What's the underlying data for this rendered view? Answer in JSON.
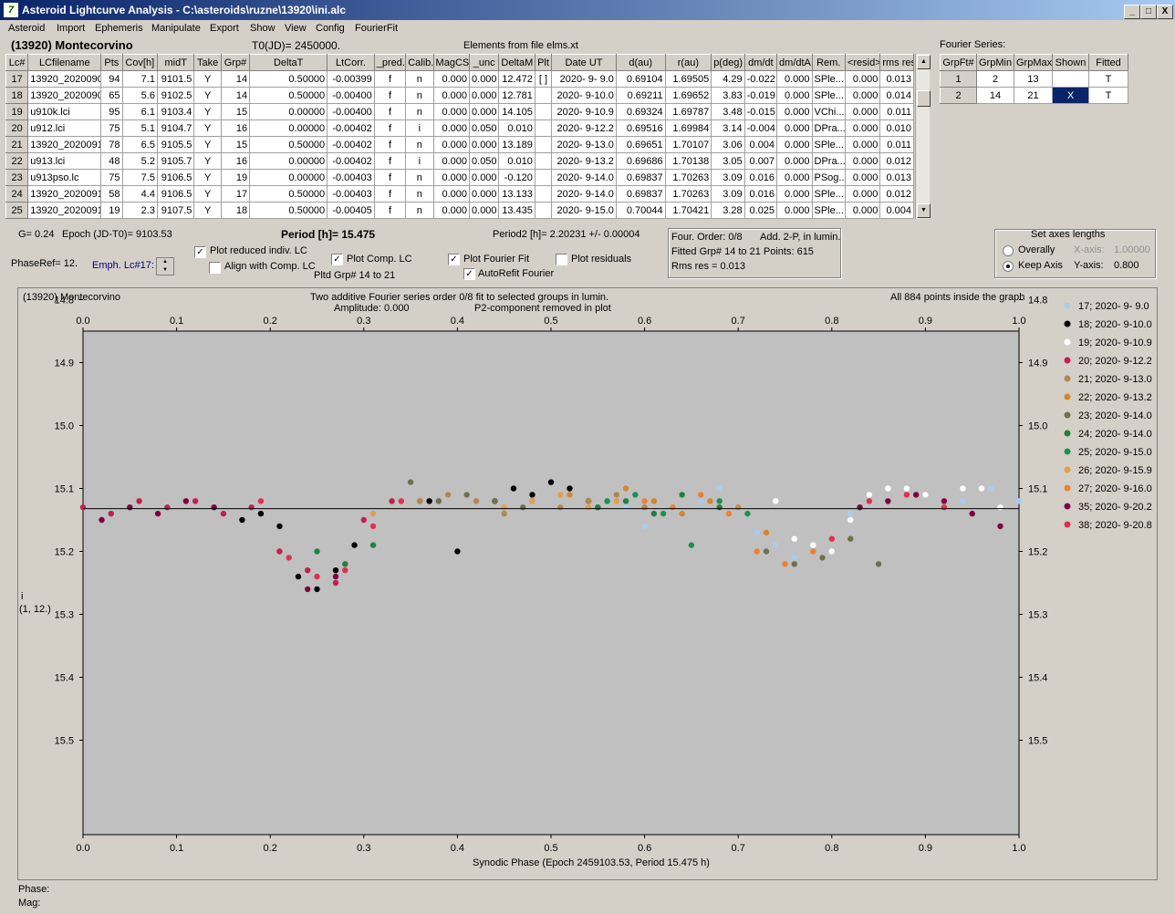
{
  "window": {
    "title": "Asteroid Lightcurve Analysis - C:\\asteroids\\ruzne\\13920\\ini.alc",
    "buttons": [
      "_",
      "□",
      "X"
    ]
  },
  "menu": [
    "Asteroid",
    "Import",
    "Ephemeris",
    "Manipulate",
    "Export",
    "Show",
    "View",
    "Config",
    "FourierFit"
  ],
  "header": {
    "asteroid_name": "(13920) Montecorvino",
    "t0": "T0(JD)= 2450000.",
    "elements": "Elements from file elms.xt",
    "fourier_label": "Fourier Series:"
  },
  "lc_table": {
    "columns": [
      "Lc#",
      "LCfilename",
      "Pts",
      "Cov[h]",
      "midT",
      "Take",
      "Grp#",
      "DeltaT",
      "LtCorr.",
      "_pred.",
      "Calib.",
      "MagCS",
      "_unc",
      "DeltaM",
      "Plt",
      "Date UT",
      "d(au)",
      "r(au)",
      "p(deg)",
      "dm/dt",
      "dm/dtA",
      "Rem.",
      "<resid>",
      "rms res"
    ],
    "rows": [
      [
        "17",
        "13920_2020090",
        "94",
        "7.1",
        "9101.5",
        "Y",
        "14",
        "0.50000",
        "-0.00399",
        "f",
        "n",
        "0.000",
        "0.000",
        "12.472",
        "[ ]",
        "2020- 9- 9.0",
        "0.69104",
        "1.69505",
        "4.29",
        "-0.022",
        "0.000",
        "SPle...",
        "0.000",
        "0.013"
      ],
      [
        "18",
        "13920_2020090",
        "65",
        "5.6",
        "9102.5",
        "Y",
        "14",
        "0.50000",
        "-0.00400",
        "f",
        "n",
        "0.000",
        "0.000",
        "12.781",
        "",
        "2020- 9-10.0",
        "0.69211",
        "1.69652",
        "3.83",
        "-0.019",
        "0.000",
        "SPle...",
        "0.000",
        "0.014"
      ],
      [
        "19",
        "u910k.lci",
        "95",
        "6.1",
        "9103.4",
        "Y",
        "15",
        "0.00000",
        "-0.00400",
        "f",
        "n",
        "0.000",
        "0.000",
        "14.105",
        "",
        "2020- 9-10.9",
        "0.69324",
        "1.69787",
        "3.48",
        "-0.015",
        "0.000",
        "VChi...",
        "0.000",
        "0.011"
      ],
      [
        "20",
        "u912.lci",
        "75",
        "5.1",
        "9104.7",
        "Y",
        "16",
        "0.00000",
        "-0.00402",
        "f",
        "i",
        "0.000",
        "0.050",
        "0.010",
        "",
        "2020- 9-12.2",
        "0.69516",
        "1.69984",
        "3.14",
        "-0.004",
        "0.000",
        "DPra...",
        "0.000",
        "0.010"
      ],
      [
        "21",
        "13920_2020091",
        "78",
        "6.5",
        "9105.5",
        "Y",
        "15",
        "0.50000",
        "-0.00402",
        "f",
        "n",
        "0.000",
        "0.000",
        "13.189",
        "",
        "2020- 9-13.0",
        "0.69651",
        "1.70107",
        "3.06",
        "0.004",
        "0.000",
        "SPle...",
        "0.000",
        "0.011"
      ],
      [
        "22",
        "u913.lci",
        "48",
        "5.2",
        "9105.7",
        "Y",
        "16",
        "0.00000",
        "-0.00402",
        "f",
        "i",
        "0.000",
        "0.050",
        "0.010",
        "",
        "2020- 9-13.2",
        "0.69686",
        "1.70138",
        "3.05",
        "0.007",
        "0.000",
        "DPra...",
        "0.000",
        "0.012"
      ],
      [
        "23",
        "u913pso.lc",
        "75",
        "7.5",
        "9106.5",
        "Y",
        "19",
        "0.00000",
        "-0.00403",
        "f",
        "n",
        "0.000",
        "0.000",
        "-0.120",
        "",
        "2020- 9-14.0",
        "0.69837",
        "1.70263",
        "3.09",
        "0.016",
        "0.000",
        "PSog...",
        "0.000",
        "0.013"
      ],
      [
        "24",
        "13920_2020091",
        "58",
        "4.4",
        "9106.5",
        "Y",
        "17",
        "0.50000",
        "-0.00403",
        "f",
        "n",
        "0.000",
        "0.000",
        "13.133",
        "",
        "2020- 9-14.0",
        "0.69837",
        "1.70263",
        "3.09",
        "0.016",
        "0.000",
        "SPle...",
        "0.000",
        "0.012"
      ],
      [
        "25",
        "13920_2020091",
        "19",
        "2.3",
        "9107.5",
        "Y",
        "18",
        "0.50000",
        "-0.00405",
        "f",
        "n",
        "0.000",
        "0.000",
        "13.435",
        "",
        "2020- 9-15.0",
        "0.70044",
        "1.70421",
        "3.28",
        "0.025",
        "0.000",
        "SPle...",
        "0.000",
        "0.004"
      ]
    ]
  },
  "fourier_table": {
    "columns": [
      "GrpFt#",
      "GrpMin",
      "GrpMax",
      "Shown",
      "Fitted"
    ],
    "rows": [
      [
        "1",
        "2",
        "13",
        "",
        "T"
      ],
      [
        "2",
        "14",
        "21",
        "X",
        "T"
      ]
    ]
  },
  "controls": {
    "g": "G= 0.24",
    "epoch": "Epoch (JD-T0)= 9103.53",
    "period": "Period [h]= 15.475",
    "period2": "Period2 [h]= 2.20231 +/- 0.00004",
    "phaseref": "PhaseRef= 12.",
    "emph": "Emph. Lc#17:",
    "plot_reduced": "Plot reduced indiv. LC",
    "align_comp": "Align with Comp. LC",
    "plot_comp": "Plot Comp. LC",
    "pltd_grp": "Pltd Grp#  14 to  21",
    "plot_fourier": "Plot Fourier Fit",
    "autorefit": "AutoRefit Fourier",
    "plot_residuals": "Plot residuals",
    "four_order": "Four. Order:  0/8",
    "add_2p": "Add. 2-P, in lumin.",
    "fitted_grp": "Fitted Grp# 14 to 21 Points: 615",
    "rms_res": "Rms res     = 0.013",
    "axes_title": "Set axes lengths",
    "overally": "Overally",
    "keep_axis": "Keep Axis",
    "x_axis_label": "X-axis:",
    "x_axis_val": "1.00000",
    "y_axis_label": "Y-axis:",
    "y_axis_val": "0.800"
  },
  "plot": {
    "name": "(13920) Montecorvino",
    "line1": "Two additive Fourier series order 0/8 fit to selected groups in lumin.",
    "line2": "Amplitude: 0.000",
    "line3": "P2-component removed in plot",
    "points_note": "All 884 points inside the graph",
    "ylabel1": "i",
    "ylabel2": "(1, 12.)",
    "xlabel": "Synodic Phase (Epoch 2459103.53, Period 15.475 h)",
    "phase": "Phase:",
    "mag": "Mag:"
  },
  "chart_data": {
    "type": "scatter",
    "xlim": [
      0,
      1.0
    ],
    "ylim": [
      15.65,
      14.85
    ],
    "xticks": [
      "0.0",
      "0.1",
      "0.2",
      "0.3",
      "0.4",
      "0.5",
      "0.6",
      "0.7",
      "0.8",
      "0.9",
      "1.0"
    ],
    "yticks": [
      "14.8",
      "14.9",
      "15.0",
      "15.1",
      "15.2",
      "15.3",
      "15.4",
      "15.5"
    ],
    "fit_line_y": 15.132,
    "series": [
      {
        "name": "17; 2020- 9- 9.0",
        "color": "#a8ccf0",
        "x": [
          0.58,
          0.6,
          0.62,
          0.66,
          0.68,
          0.7,
          0.72,
          0.74,
          0.76,
          0.78,
          0.82,
          0.86,
          0.9,
          0.94,
          0.97,
          1.0
        ],
        "y": [
          15.13,
          15.16,
          15.14,
          15.12,
          15.1,
          15.13,
          15.17,
          15.19,
          15.21,
          15.19,
          15.14,
          15.12,
          15.11,
          15.12,
          15.1,
          15.12
        ]
      },
      {
        "name": "18; 2020- 9-10.0",
        "color": "#000000",
        "x": [
          0.17,
          0.19,
          0.21,
          0.23,
          0.25,
          0.27,
          0.29,
          0.37,
          0.4,
          0.44,
          0.46,
          0.48,
          0.5,
          0.52,
          0.54
        ],
        "y": [
          15.15,
          15.14,
          15.16,
          15.24,
          15.26,
          15.23,
          15.19,
          15.12,
          15.2,
          15.12,
          15.1,
          15.11,
          15.09,
          15.1,
          15.12
        ]
      },
      {
        "name": "19; 2020- 9-10.9",
        "color": "#ffffff",
        "x": [
          0.74,
          0.76,
          0.78,
          0.8,
          0.82,
          0.84,
          0.86,
          0.88,
          0.9,
          0.92,
          0.94,
          0.96,
          0.98
        ],
        "y": [
          15.12,
          15.18,
          15.19,
          15.2,
          15.15,
          15.11,
          15.1,
          15.1,
          15.11,
          15.12,
          15.1,
          15.1,
          15.13
        ]
      },
      {
        "name": "20; 2020- 9-12.2",
        "color": "#c02050",
        "x": [
          0.0,
          0.03,
          0.06,
          0.09,
          0.12,
          0.15,
          0.18,
          0.21,
          0.24,
          0.27,
          0.3,
          0.33,
          0.36
        ],
        "y": [
          15.13,
          15.14,
          15.12,
          15.13,
          15.12,
          15.14,
          15.13,
          15.2,
          15.23,
          15.25,
          15.15,
          15.12,
          15.12
        ]
      },
      {
        "name": "21; 2020- 9-13.0",
        "color": "#b08850",
        "x": [
          0.36,
          0.39,
          0.42,
          0.45,
          0.48,
          0.51,
          0.54,
          0.57,
          0.6
        ],
        "y": [
          15.12,
          15.11,
          15.12,
          15.14,
          15.12,
          15.13,
          15.12,
          15.11,
          15.13
        ]
      },
      {
        "name": "22; 2020- 9-13.2",
        "color": "#d08830",
        "x": [
          0.52,
          0.55,
          0.58,
          0.61,
          0.64,
          0.67,
          0.7,
          0.73
        ],
        "y": [
          15.11,
          15.13,
          15.1,
          15.12,
          15.14,
          15.12,
          15.13,
          15.17
        ]
      },
      {
        "name": "23; 2020- 9-14.0",
        "color": "#707050",
        "x": [
          0.35,
          0.38,
          0.41,
          0.44,
          0.47,
          0.73,
          0.76,
          0.79,
          0.82,
          0.85
        ],
        "y": [
          15.09,
          15.12,
          15.11,
          15.12,
          15.13,
          15.2,
          15.22,
          15.21,
          15.18,
          15.22
        ]
      },
      {
        "name": "24; 2020- 9-14.0",
        "color": "#208040",
        "x": [
          0.25,
          0.28,
          0.31,
          0.55,
          0.58,
          0.61,
          0.64,
          0.68
        ],
        "y": [
          15.2,
          15.22,
          15.19,
          15.13,
          15.12,
          15.14,
          15.11,
          15.13
        ]
      },
      {
        "name": "25; 2020- 9-15.0",
        "color": "#209050",
        "x": [
          0.56,
          0.59,
          0.62,
          0.65,
          0.68,
          0.71
        ],
        "y": [
          15.12,
          15.11,
          15.14,
          15.19,
          15.12,
          15.14
        ]
      },
      {
        "name": "26; 2020- 9-15.9",
        "color": "#e0a050",
        "x": [
          0.28,
          0.31,
          0.45,
          0.48,
          0.51,
          0.54,
          0.57
        ],
        "y": [
          15.23,
          15.14,
          15.13,
          15.12,
          15.11,
          15.13,
          15.12
        ]
      },
      {
        "name": "27; 2020- 9-16.0",
        "color": "#f08030",
        "x": [
          0.6,
          0.63,
          0.66,
          0.69,
          0.72,
          0.75,
          0.78
        ],
        "y": [
          15.12,
          15.13,
          15.11,
          15.14,
          15.2,
          15.22,
          15.2
        ]
      },
      {
        "name": "35; 2020- 9-20.2",
        "color": "#800040",
        "x": [
          0.02,
          0.05,
          0.08,
          0.11,
          0.14,
          0.24,
          0.27,
          0.83,
          0.86,
          0.89,
          0.92,
          0.95,
          0.98
        ],
        "y": [
          15.15,
          15.13,
          15.14,
          15.12,
          15.13,
          15.26,
          15.24,
          15.13,
          15.12,
          15.11,
          15.12,
          15.14,
          15.16
        ]
      },
      {
        "name": "38; 2020- 9-20.8",
        "color": "#e03050",
        "x": [
          0.19,
          0.22,
          0.25,
          0.28,
          0.31,
          0.34,
          0.8,
          0.84,
          0.88,
          0.92
        ],
        "y": [
          15.12,
          15.21,
          15.24,
          15.23,
          15.16,
          15.12,
          15.18,
          15.12,
          15.11,
          15.13
        ]
      }
    ]
  }
}
